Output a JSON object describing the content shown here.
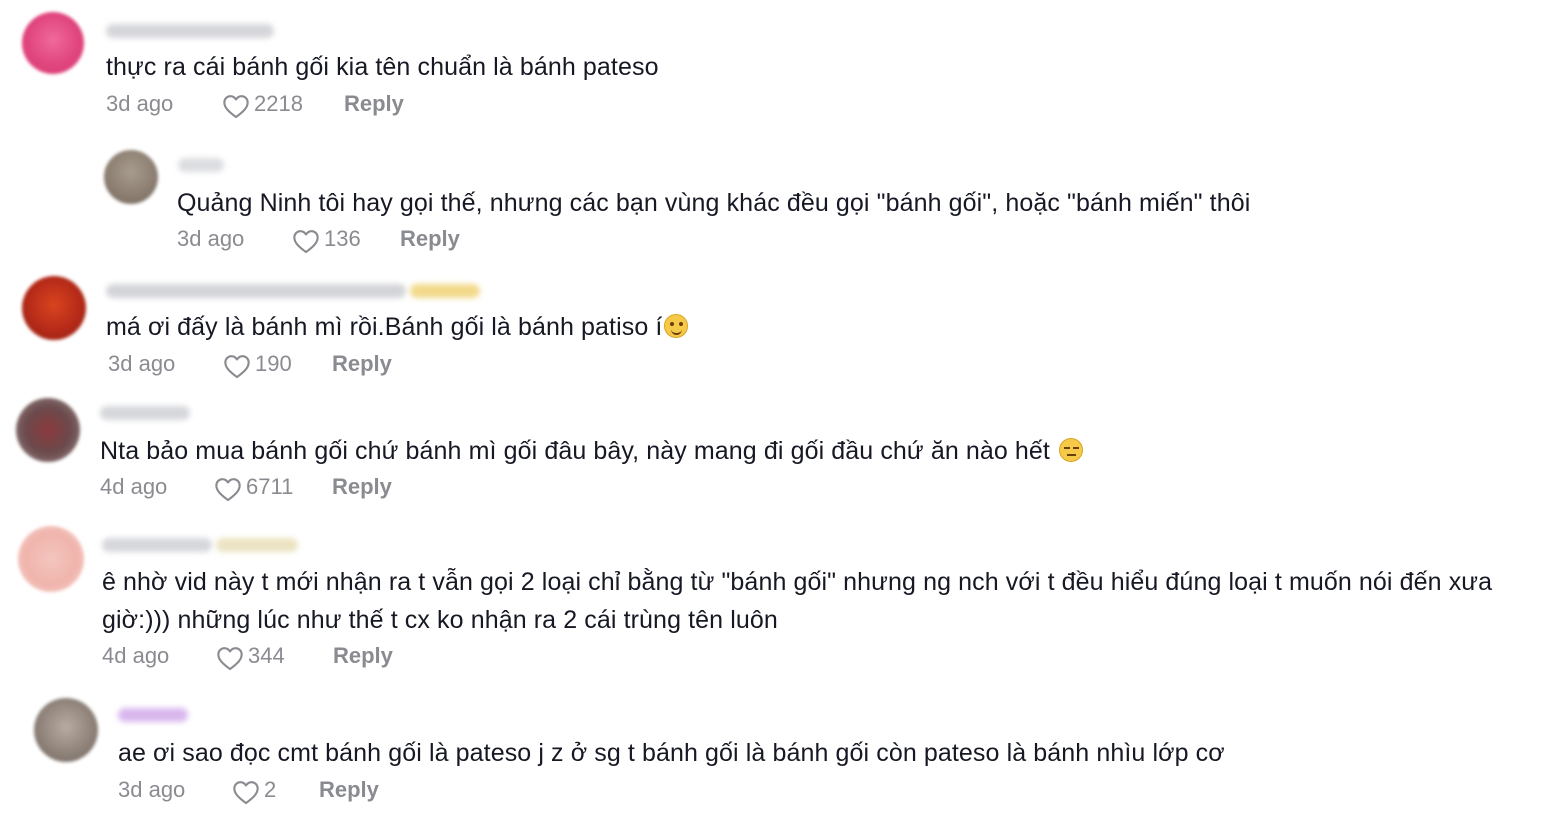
{
  "colors": {
    "text": "#161823",
    "meta": "#8a8b91",
    "background": "#ffffff"
  },
  "icons": {
    "like": "heart-outline-icon",
    "emoji_smile": "smiling-face-emoji",
    "emoji_neutral": "expressionless-face-emoji"
  },
  "comments": [
    {
      "text": "thực ra cái bánh gối kia tên chuẩn là bánh pateso",
      "time": "3d ago",
      "likes": "2218",
      "reply_label": "Reply"
    },
    {
      "text": "Quảng Ninh tôi hay gọi thế, nhưng các bạn vùng khác đều gọi \"bánh gối\", hoặc \"bánh miến\" thôi",
      "time": "3d ago",
      "likes": "136",
      "reply_label": "Reply"
    },
    {
      "text": "má ơi đấy là bánh mì rồi.Bánh gối là bánh patiso í",
      "time": "3d ago",
      "likes": "190",
      "reply_label": "Reply"
    },
    {
      "text": "Nta bảo mua bánh gối chứ bánh mì gối đâu bây, này mang đi gối đầu chứ ăn nào hết",
      "time": "4d ago",
      "likes": "6711",
      "reply_label": "Reply"
    },
    {
      "text": "ê nhờ vid này t mới nhận ra t vẫn gọi 2 loại chỉ bằng từ \"bánh gối\" nhưng ng nch với t đều hiểu đúng loại t muốn nói đến xưa giờ:))) những lúc như thế t cx ko nhận ra 2 cái trùng tên luôn",
      "time": "4d ago",
      "likes": "344",
      "reply_label": "Reply"
    },
    {
      "text": "ae ơi sao đọc cmt bánh gối là pateso j z ở sg t bánh gối là bánh gối còn pateso là bánh nhìu lớp cơ",
      "time": "3d ago",
      "likes": "2",
      "reply_label": "Reply"
    }
  ]
}
